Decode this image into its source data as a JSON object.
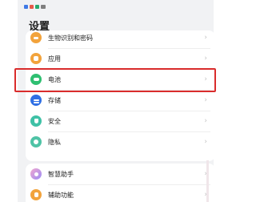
{
  "page_title": "设置",
  "colors": {
    "highlight": "#d92c2c",
    "biometric": "#f2a33c",
    "apps": "#f2a33c",
    "battery": "#2fbf71",
    "storage": "#2f6fe4",
    "security": "#3fc1a6",
    "privacy": "#4fc3a6",
    "assistant": "#9b8cf5",
    "accessibility": "#f2a33c"
  },
  "settings_group_1": [
    {
      "label": "生物识别和密码",
      "icon": "key-icon"
    },
    {
      "label": "应用",
      "icon": "apps-grid-icon"
    },
    {
      "label": "电池",
      "icon": "battery-icon"
    },
    {
      "label": "存储",
      "icon": "storage-icon"
    },
    {
      "label": "安全",
      "icon": "shield-check-icon"
    },
    {
      "label": "隐私",
      "icon": "privacy-eye-icon"
    }
  ],
  "settings_group_2": [
    {
      "label": "智慧助手",
      "icon": "smart-assistant-icon"
    },
    {
      "label": "辅助功能",
      "icon": "accessibility-hand-icon"
    }
  ],
  "chevron": "›"
}
